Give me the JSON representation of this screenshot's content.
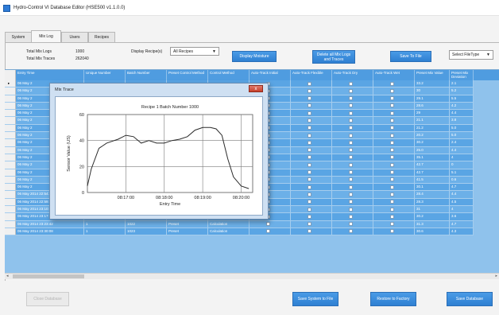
{
  "window": {
    "title": "Hydro-Control VI Database Editor (HSE500 v1.1.0.0)"
  },
  "tabs": [
    {
      "label": "System"
    },
    {
      "label": "Mix Log"
    },
    {
      "label": "Users"
    },
    {
      "label": "Recipes"
    }
  ],
  "summary": {
    "total_mix_logs_label": "Total Mix Logs",
    "total_mix_logs_value": "1000",
    "total_mix_traces_label": "Total Mix Traces",
    "total_mix_traces_value": "262040",
    "display_recipes_label": "Display Recipe(s)",
    "display_recipes_value": "All Recipes"
  },
  "buttons": {
    "display_moisture": "Display Moisture",
    "delete_all": "Delete all Mix Logs and Traces",
    "save_to_file": "Save To File",
    "file_type": "Select FileType",
    "close_database": "Close Database",
    "save_system_to_file": "Save System to File",
    "restore_to_factory": "Restore to Factory",
    "save_database": "Save Database"
  },
  "table": {
    "columns": [
      "Entry Time",
      "Unique Number",
      "Batch Number",
      "Preset Control Method",
      "Control Method",
      "Auto-Track Initial",
      "Auto-Track Flexible",
      "Auto-Track Dry",
      "Auto-Track Wet",
      "Preset Mix Value",
      "Preset Mix Deviation"
    ],
    "rows": [
      {
        "entry": "06 May 2",
        "unique": "",
        "batch": "",
        "preset": "",
        "control": "",
        "pmv": "33.2",
        "dev": "2.1"
      },
      {
        "entry": "06 May 2",
        "unique": "",
        "batch": "",
        "preset": "",
        "control": "",
        "pmv": "30",
        "dev": "5.2"
      },
      {
        "entry": "06 May 2",
        "unique": "",
        "batch": "",
        "preset": "",
        "control": "",
        "pmv": "29.1",
        "dev": "5.5"
      },
      {
        "entry": "06 May 2",
        "unique": "",
        "batch": "",
        "preset": "",
        "control": "",
        "pmv": "28.6",
        "dev": "4.2"
      },
      {
        "entry": "06 May 2",
        "unique": "",
        "batch": "",
        "preset": "",
        "control": "",
        "pmv": "29",
        "dev": "4.4"
      },
      {
        "entry": "06 May 2",
        "unique": "",
        "batch": "",
        "preset": "",
        "control": "",
        "pmv": "21.1",
        "dev": "3.8"
      },
      {
        "entry": "06 May 2",
        "unique": "",
        "batch": "",
        "preset": "",
        "control": "",
        "pmv": "21.2",
        "dev": "5.0"
      },
      {
        "entry": "06 May 2",
        "unique": "",
        "batch": "",
        "preset": "",
        "control": "",
        "pmv": "20.2",
        "dev": "5.0"
      },
      {
        "entry": "06 May 2",
        "unique": "",
        "batch": "",
        "preset": "",
        "control": "",
        "pmv": "30.2",
        "dev": "2.4"
      },
      {
        "entry": "06 May 2",
        "unique": "",
        "batch": "",
        "preset": "",
        "control": "",
        "pmv": "25.0",
        "dev": "4.4"
      },
      {
        "entry": "06 May 2",
        "unique": "",
        "batch": "",
        "preset": "",
        "control": "",
        "pmv": "35.1",
        "dev": "4"
      },
      {
        "entry": "06 May 2",
        "unique": "",
        "batch": "",
        "preset": "",
        "control": "",
        "pmv": "42.7",
        "dev": "0"
      },
      {
        "entry": "06 May 2",
        "unique": "",
        "batch": "",
        "preset": "",
        "control": "",
        "pmv": "42.7",
        "dev": "5.1"
      },
      {
        "entry": "06 May 2",
        "unique": "",
        "batch": "",
        "preset": "",
        "control": "",
        "pmv": "41.5",
        "dev": "0.6"
      },
      {
        "entry": "06 May 2",
        "unique": "",
        "batch": "",
        "preset": "",
        "control": "",
        "pmv": "30.1",
        "dev": "4.7"
      },
      {
        "entry": "06 May 2014 22:54:45",
        "unique": "1",
        "batch": "1018",
        "preset": "Preset",
        "control": "Calculation",
        "pmv": "28.4",
        "dev": "4.4"
      },
      {
        "entry": "06 May 2014 22:59:48",
        "unique": "1",
        "batch": "1019",
        "preset": "Preset",
        "control": "Calculation",
        "pmv": "28.3",
        "dev": "4.5"
      },
      {
        "entry": "06 May 2014 23:10:52",
        "unique": "1",
        "batch": "1020",
        "preset": "Preset",
        "control": "Calculation",
        "pmv": "31",
        "dev": "4"
      },
      {
        "entry": "06 May 2014 23:17:17",
        "unique": "1",
        "batch": "1021",
        "preset": "Preset",
        "control": "Calculation",
        "pmv": "30.2",
        "dev": "3.6"
      },
      {
        "entry": "06 May 2014 23:23:42",
        "unique": "1",
        "batch": "1022",
        "preset": "Preset",
        "control": "Calculation",
        "pmv": "31.3",
        "dev": "4.7"
      },
      {
        "entry": "06 May 2014 23:30:08",
        "unique": "1",
        "batch": "1023",
        "preset": "Preset",
        "control": "Calculation",
        "pmv": "30.6",
        "dev": "4.3"
      }
    ]
  },
  "dialog": {
    "title": "Mix Trace",
    "close_glyph": "x"
  },
  "chart_data": {
    "type": "line",
    "title": "Recipe 1  Batch Number 1000",
    "xlabel": "Entry Time",
    "ylabel": "Sensor Value (US)",
    "xticks": [
      "08:17:00",
      "08:18:00",
      "08:19:00",
      "08:20:00"
    ],
    "yticks": [
      0,
      20,
      40,
      60
    ],
    "ylim": [
      0,
      60
    ],
    "xlim": [
      0,
      4.3
    ],
    "grid": true,
    "series": [
      {
        "x": [
          0,
          0.1,
          0.3,
          0.5,
          0.8,
          1.0,
          1.2,
          1.4,
          1.6,
          1.8,
          2.0,
          2.2,
          2.4,
          2.6,
          2.8,
          3.0,
          3.2,
          3.35,
          3.5,
          3.65,
          3.8,
          4.0,
          4.2
        ],
        "y": [
          5,
          18,
          34,
          38,
          41,
          44,
          43,
          38,
          40,
          38,
          38,
          40,
          41,
          43,
          48,
          50,
          50,
          49,
          44,
          26,
          12,
          5,
          3
        ]
      }
    ],
    "colors": {
      "line": "#2b2b2b",
      "grid": "#7a7a7a"
    }
  },
  "colors": {
    "header_blue": "#4f9ce0",
    "row_blue": "#5aa5e4",
    "button_blue": "#2f80d2"
  }
}
